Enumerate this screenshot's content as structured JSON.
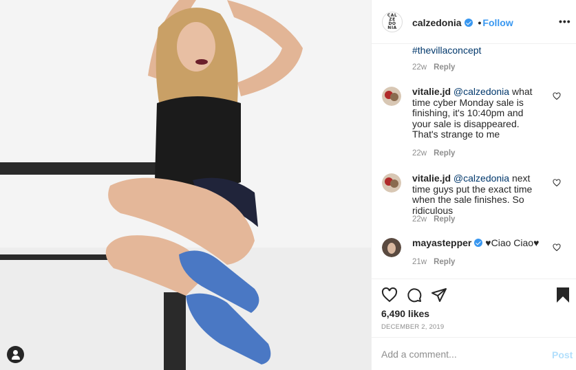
{
  "header": {
    "logo_text": "CAL\nZE\nDO\nNIA",
    "username": "calzedonia",
    "follow_label": "Follow",
    "separator": "•",
    "more_label": "•••"
  },
  "caption_tail": {
    "hashtag": "#thevillaconcept",
    "age": "22w",
    "reply": "Reply"
  },
  "comments": [
    {
      "username": "vitalie.jd",
      "mention": "@calzedonia",
      "text": " what time cyber Monday sale is finishing, it's 10:40pm and your sale is disappeared. That's strange to me",
      "age": "22w",
      "reply": "Reply"
    },
    {
      "username": "vitalie.jd",
      "mention": "@calzedonia",
      "text": " next time guys put the exact time when the sale finishes. So ridiculous",
      "age": "22w",
      "reply": "Reply"
    },
    {
      "username": "mayastepper",
      "mention": "",
      "text": "♥Ciao Ciao♥",
      "age": "21w",
      "reply": "Reply"
    }
  ],
  "post": {
    "likes": "6,490 likes",
    "date": "DECEMBER 2, 2019"
  },
  "add_comment": {
    "placeholder": "Add a comment...",
    "post_label": "Post"
  },
  "colors": {
    "link": "#3897f0",
    "mention": "#00376b",
    "muted": "#8e8e8e",
    "post_disabled": "#b2dffc"
  }
}
